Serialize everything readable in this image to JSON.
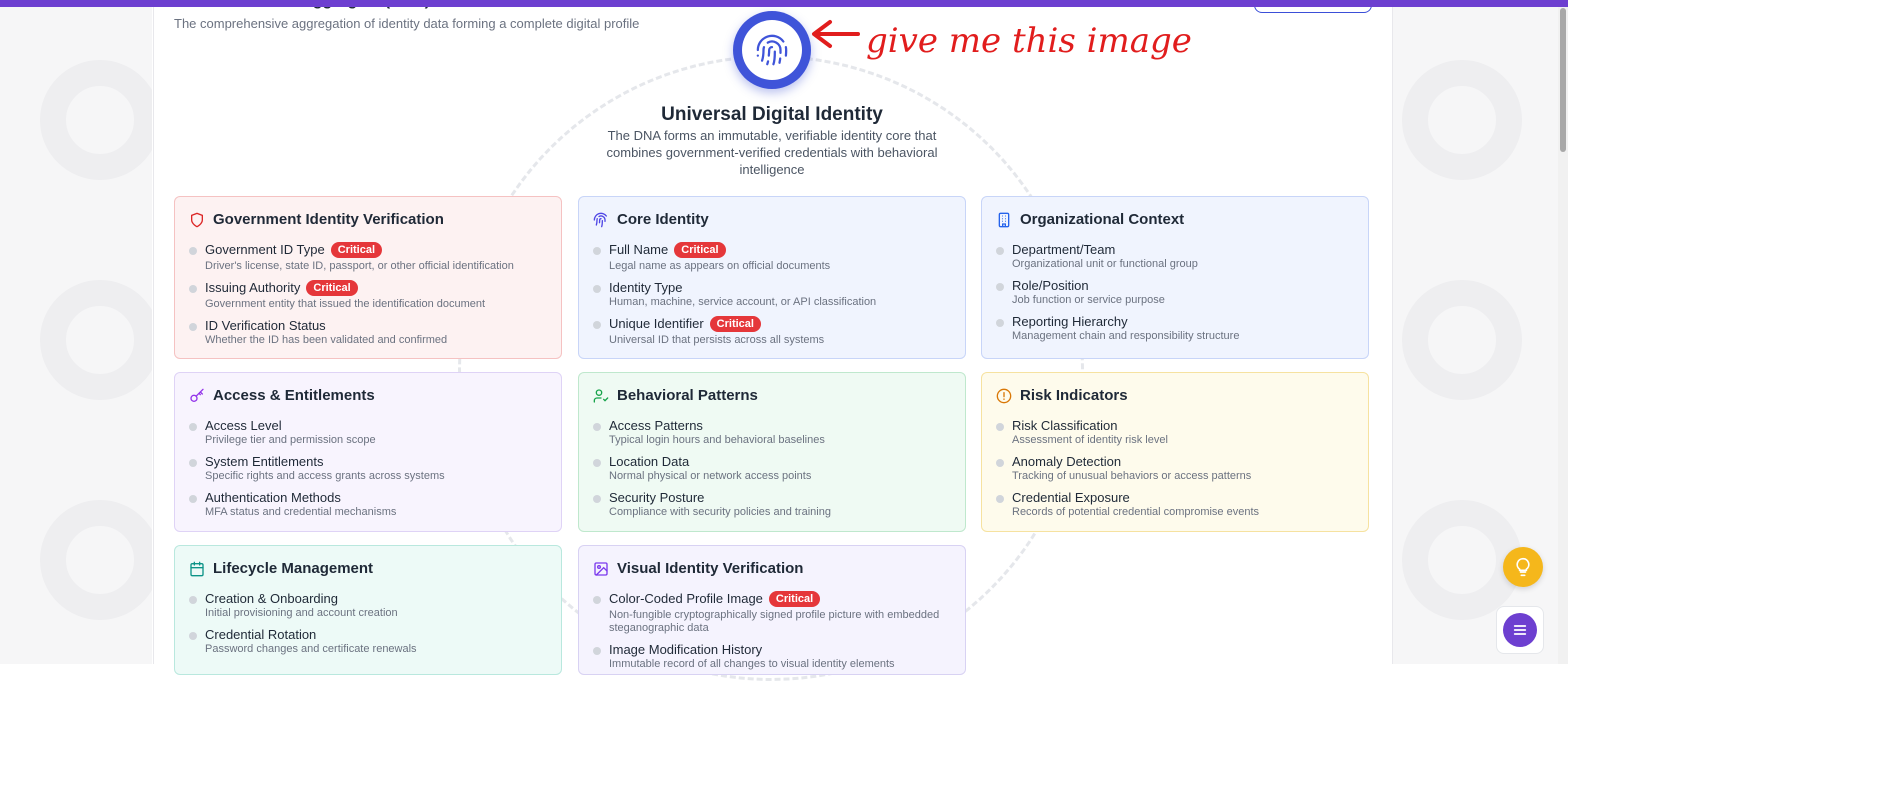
{
  "header": {
    "title": "Data Nucleus Aggregate (DNA)",
    "subtitle": "The comprehensive aggregation of identity data forming a complete digital profile"
  },
  "hero": {
    "title": "Universal Digital Identity",
    "description": "The DNA forms an immutable, verifiable identity core that combines government-verified credentials with behavioral intelligence",
    "icon": "fingerprint-icon"
  },
  "annotation": {
    "text": "give me this image",
    "color": "#e11d1d"
  },
  "badge_label": "Critical",
  "cards": [
    {
      "title": "Government Identity Verification",
      "icon": "shield-icon",
      "items": [
        {
          "label": "Government ID Type",
          "critical": true,
          "desc": "Driver's license, state ID, passport, or other official identification"
        },
        {
          "label": "Issuing Authority",
          "critical": true,
          "desc": "Government entity that issued the identification document"
        },
        {
          "label": "ID Verification Status",
          "critical": false,
          "desc": "Whether the ID has been validated and confirmed"
        }
      ]
    },
    {
      "title": "Core Identity",
      "icon": "fingerprint-icon",
      "items": [
        {
          "label": "Full Name",
          "critical": true,
          "desc": "Legal name as appears on official documents"
        },
        {
          "label": "Identity Type",
          "critical": false,
          "desc": "Human, machine, service account, or API classification"
        },
        {
          "label": "Unique Identifier",
          "critical": true,
          "desc": "Universal ID that persists across all systems"
        }
      ]
    },
    {
      "title": "Organizational Context",
      "icon": "building-icon",
      "items": [
        {
          "label": "Department/Team",
          "critical": false,
          "desc": "Organizational unit or functional group"
        },
        {
          "label": "Role/Position",
          "critical": false,
          "desc": "Job function or service purpose"
        },
        {
          "label": "Reporting Hierarchy",
          "critical": false,
          "desc": "Management chain and responsibility structure"
        }
      ]
    },
    {
      "title": "Access & Entitlements",
      "icon": "key-icon",
      "items": [
        {
          "label": "Access Level",
          "critical": false,
          "desc": "Privilege tier and permission scope"
        },
        {
          "label": "System Entitlements",
          "critical": false,
          "desc": "Specific rights and access grants across systems"
        },
        {
          "label": "Authentication Methods",
          "critical": false,
          "desc": "MFA status and credential mechanisms"
        }
      ]
    },
    {
      "title": "Behavioral Patterns",
      "icon": "user-check-icon",
      "items": [
        {
          "label": "Access Patterns",
          "critical": false,
          "desc": "Typical login hours and behavioral baselines"
        },
        {
          "label": "Location Data",
          "critical": false,
          "desc": "Normal physical or network access points"
        },
        {
          "label": "Security Posture",
          "critical": false,
          "desc": "Compliance with security policies and training"
        }
      ]
    },
    {
      "title": "Risk Indicators",
      "icon": "alert-circle-icon",
      "items": [
        {
          "label": "Risk Classification",
          "critical": false,
          "desc": "Assessment of identity risk level"
        },
        {
          "label": "Anomaly Detection",
          "critical": false,
          "desc": "Tracking of unusual behaviors or access patterns"
        },
        {
          "label": "Credential Exposure",
          "critical": false,
          "desc": "Records of potential credential compromise events"
        }
      ]
    },
    {
      "title": "Lifecycle Management",
      "icon": "calendar-icon",
      "items": [
        {
          "label": "Creation & Onboarding",
          "critical": false,
          "desc": "Initial provisioning and account creation"
        },
        {
          "label": "Credential Rotation",
          "critical": false,
          "desc": "Password changes and certificate renewals"
        }
      ]
    },
    {
      "title": "Visual Identity Verification",
      "icon": "image-icon",
      "items": [
        {
          "label": "Color-Coded Profile Image",
          "critical": true,
          "desc": "Non-fungible cryptographically signed profile picture with embedded steganographic data"
        },
        {
          "label": "Image Modification History",
          "critical": false,
          "desc": "Immutable record of all changes to visual identity elements"
        }
      ]
    }
  ],
  "colors": {
    "brand": "#6d3fd0",
    "hero_blue": "#3f54d9",
    "critical": "#e5373a",
    "bulb": "#f5b71b"
  },
  "floating": {
    "bulb_icon": "lightbulb-icon",
    "menu_icon": "menu-icon"
  }
}
